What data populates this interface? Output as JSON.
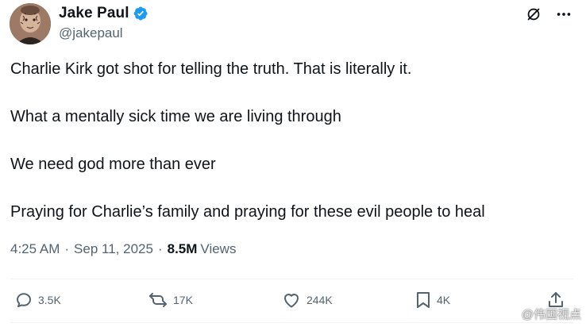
{
  "author": {
    "display_name": "Jake Paul",
    "handle": "@jakepaul",
    "verified": true,
    "verified_color": "#1d9bf0"
  },
  "header_actions": [
    {
      "icon": "grok-icon"
    },
    {
      "icon": "more-icon"
    }
  ],
  "tweet": {
    "paragraphs": [
      "Charlie Kirk got shot for telling the truth. That is literally it.",
      "What a mentally sick time we are living through",
      "We need god more than ever",
      "Praying for Charlie’s family and praying for these evil people to heal"
    ]
  },
  "meta": {
    "time": "4:25 AM",
    "separator": "·",
    "date": "Sep 11, 2025",
    "views_count": "8.5M",
    "views_label": "Views"
  },
  "actions": {
    "reply": {
      "icon": "reply-icon",
      "count": "3.5K"
    },
    "repost": {
      "icon": "repost-icon",
      "count": "17K"
    },
    "like": {
      "icon": "heart-icon",
      "count": "244K"
    },
    "bookmark": {
      "icon": "bookmark-icon",
      "count": "4K"
    },
    "share": {
      "icon": "share-icon"
    }
  },
  "watermark": {
    "text": "@伟国视点"
  },
  "colors": {
    "text_primary": "#0f1419",
    "text_secondary": "#536471",
    "divider": "#eff3f4"
  }
}
